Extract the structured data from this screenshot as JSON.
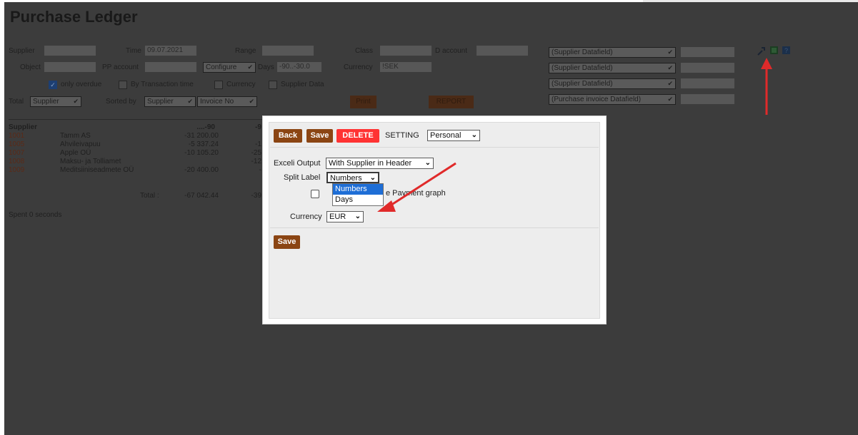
{
  "page": {
    "title": "Purchase Ledger",
    "filters": {
      "supplier_label": "Supplier",
      "time_label": "Time",
      "time_value": "09.07.2021",
      "range_label": "Range",
      "class_label": "Class",
      "d_account_label": "D account",
      "object_label": "Object",
      "pp_account_label": "PP account",
      "configure_select": "Configure",
      "days_label": "Days",
      "days_value": "-90..-30.0",
      "currency_label": "Currency",
      "currency_value": "!SEK",
      "only_overdue_label": "only overdue",
      "by_transaction_time_label": "By Transaction time",
      "currency_check_label": "Currency",
      "supplier_data_label": "Supplier Data",
      "total_label": "Total",
      "total_select": "Supplier",
      "sorted_by_label": "Sorted by",
      "sorted_by_select_1": "Supplier",
      "sorted_by_select_2": "Invoice No",
      "print_button": "Print",
      "report_button": "REPORT",
      "datafield_1": "(Supplier Datafield)",
      "datafield_2": "(Supplier Datafield)",
      "datafield_3": "(Supplier Datafield)",
      "datafield_4": "(Purchase invoice Datafield)"
    },
    "table": {
      "header_supplier": "Supplier",
      "header_col1": "....-90",
      "header_col2": "-9",
      "rows": [
        {
          "code": "1001",
          "name": "Tamm AS",
          "v1": "-31 200.00",
          "v2": ""
        },
        {
          "code": "1005",
          "name": "Ahvileivapuu",
          "v1": "-5 337.24",
          "v2": "-1"
        },
        {
          "code": "1007",
          "name": "Apple OÜ",
          "v1": "-10 105.20",
          "v2": "-25"
        },
        {
          "code": "1008",
          "name": "Maksu- ja Tolliamet",
          "v1": "",
          "v2": "-12"
        },
        {
          "code": "1009",
          "name": "Meditsiiniseadmete OÜ",
          "v1": "-20 400.00",
          "v2": "-"
        }
      ],
      "total_label": "Total :",
      "total_v1": "-67 042.44",
      "total_v2": "-39"
    },
    "spent": "Spent 0 seconds",
    "icons": [
      "wrench-icon",
      "excel-icon",
      "help-icon"
    ],
    "accent_color": "#ff3333"
  },
  "modal": {
    "back_button": "Back",
    "save_button": "Save",
    "delete_button": "DELETE",
    "setting_label": "SETTING",
    "setting_select": "Personal",
    "excel_output_label": "Exceli Output",
    "excel_output_select": "With Supplier in Header",
    "split_label_label": "Split Label",
    "split_label_select": "Numbers",
    "split_label_options": [
      "Numbers",
      "Days"
    ],
    "payment_graph_label": "e Payment graph",
    "currency_label": "Currency",
    "currency_select": "EUR",
    "bottom_save_button": "Save",
    "brand_color": "#8b4513",
    "delete_color": "#ff3333"
  }
}
